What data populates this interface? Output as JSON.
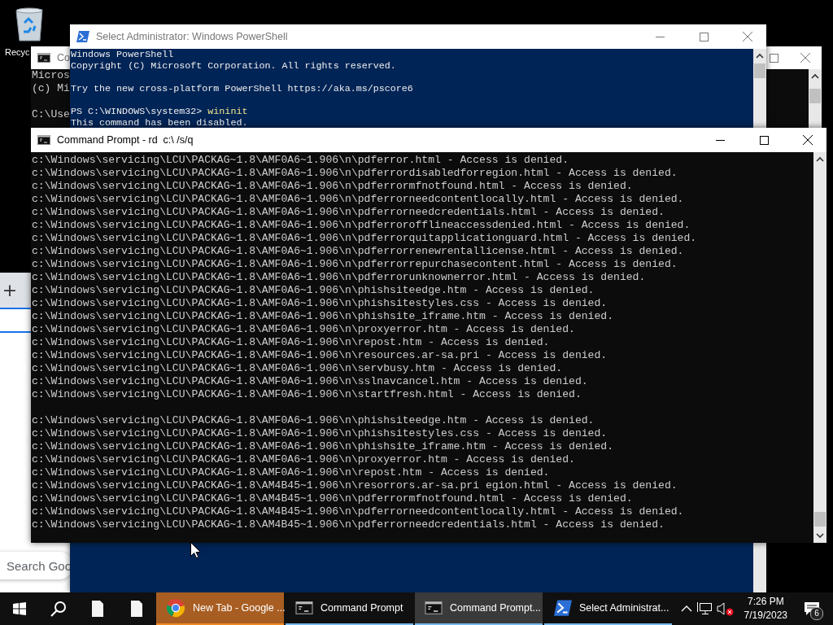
{
  "desktop": {
    "icon_label": "Recyc"
  },
  "back_console": {
    "title": "Co",
    "blocks": [
      {
        "lines": [
          {
            "text": "Micros"
          },
          {
            "text": "(c) Mi"
          }
        ]
      },
      {
        "lines": [
          {
            "text": "C:\\Use"
          }
        ]
      }
    ]
  },
  "powershell": {
    "title": "Select Administrator: Windows PowerShell",
    "blocks": [
      {
        "lines": [
          {
            "text": "Windows PowerShell"
          },
          {
            "text": "Copyright (C) Microsoft Corporation. All rights reserved."
          }
        ]
      },
      {
        "lines": [
          {
            "text": "Try the new cross-platform PowerShell https://aka.ms/pscore6"
          }
        ]
      },
      {
        "lines": [
          {
            "text": "PS C:\\WINDOWS\\system32> ",
            "command": "wininit"
          },
          {
            "text": "This command has been disabled."
          }
        ]
      }
    ]
  },
  "browser": {
    "new_tab_button": "+",
    "search_placeholder": "Search Goo"
  },
  "console": {
    "title": "Command Prompt - rd  c:\\ /s/q",
    "blocks": [
      {
        "lines": [
          {
            "text": "c:\\Windows\\servicing\\LCU\\PACKAG~1.8\\AMF0A6~1.906\\n\\pdferror.html - Access is denied."
          },
          {
            "text": "c:\\Windows\\servicing\\LCU\\PACKAG~1.8\\AMF0A6~1.906\\n\\pdferrordisabledforregion.html - Access is denied."
          },
          {
            "text": "c:\\Windows\\servicing\\LCU\\PACKAG~1.8\\AMF0A6~1.906\\n\\pdferrormfnotfound.html - Access is denied."
          },
          {
            "text": "c:\\Windows\\servicing\\LCU\\PACKAG~1.8\\AMF0A6~1.906\\n\\pdferrorneedcontentlocally.html - Access is denied."
          },
          {
            "text": "c:\\Windows\\servicing\\LCU\\PACKAG~1.8\\AMF0A6~1.906\\n\\pdferrorneedcredentials.html - Access is denied."
          },
          {
            "text": "c:\\Windows\\servicing\\LCU\\PACKAG~1.8\\AMF0A6~1.906\\n\\pdferrorofflineaccessdenied.html - Access is denied."
          },
          {
            "text": "c:\\Windows\\servicing\\LCU\\PACKAG~1.8\\AMF0A6~1.906\\n\\pdferrorquitapplicationguard.html - Access is denied."
          },
          {
            "text": "c:\\Windows\\servicing\\LCU\\PACKAG~1.8\\AMF0A6~1.906\\n\\pdferrorrenewrentallicense.html - Access is denied."
          },
          {
            "text": "c:\\Windows\\servicing\\LCU\\PACKAG~1.8\\AMF0A6~1.906\\n\\pdferrorrepurchasecontent.html - Access is denied."
          },
          {
            "text": "c:\\Windows\\servicing\\LCU\\PACKAG~1.8\\AMF0A6~1.906\\n\\pdferrorunknownerror.html - Access is denied."
          },
          {
            "text": "c:\\Windows\\servicing\\LCU\\PACKAG~1.8\\AMF0A6~1.906\\n\\phishsiteedge.htm - Access is denied."
          },
          {
            "text": "c:\\Windows\\servicing\\LCU\\PACKAG~1.8\\AMF0A6~1.906\\n\\phishsitestyles.css - Access is denied."
          },
          {
            "text": "c:\\Windows\\servicing\\LCU\\PACKAG~1.8\\AMF0A6~1.906\\n\\phishsite_iframe.htm - Access is denied."
          },
          {
            "text": "c:\\Windows\\servicing\\LCU\\PACKAG~1.8\\AMF0A6~1.906\\n\\proxyerror.htm - Access is denied."
          },
          {
            "text": "c:\\Windows\\servicing\\LCU\\PACKAG~1.8\\AMF0A6~1.906\\n\\repost.htm - Access is denied."
          },
          {
            "text": "c:\\Windows\\servicing\\LCU\\PACKAG~1.8\\AMF0A6~1.906\\n\\resources.ar-sa.pri - Access is denied."
          },
          {
            "text": "c:\\Windows\\servicing\\LCU\\PACKAG~1.8\\AMF0A6~1.906\\n\\servbusy.htm - Access is denied."
          },
          {
            "text": "c:\\Windows\\servicing\\LCU\\PACKAG~1.8\\AMF0A6~1.906\\n\\sslnavcancel.htm - Access is denied."
          },
          {
            "text": "c:\\Windows\\servicing\\LCU\\PACKAG~1.8\\AMF0A6~1.906\\n\\startfresh.html - Access is denied."
          }
        ]
      },
      {
        "lines": [
          {
            "text": "c:\\Windows\\servicing\\LCU\\PACKAG~1.8\\AMF0A6~1.906\\n\\phishsiteedge.htm - Access is denied."
          },
          {
            "text": "c:\\Windows\\servicing\\LCU\\PACKAG~1.8\\AMF0A6~1.906\\n\\phishsitestyles.css - Access is denied."
          },
          {
            "text": "c:\\Windows\\servicing\\LCU\\PACKAG~1.8\\AMF0A6~1.906\\n\\phishsite_iframe.htm - Access is denied."
          },
          {
            "text": "c:\\Windows\\servicing\\LCU\\PACKAG~1.8\\AMF0A6~1.906\\n\\proxyerror.htm - Access is denied."
          },
          {
            "text": "c:\\Windows\\servicing\\LCU\\PACKAG~1.8\\AMF0A6~1.906\\n\\repost.htm - Access is denied."
          },
          {
            "text": "c:\\Windows\\servicing\\LCU\\PACKAG~1.8\\AM4B45~1.906\\n\\resorrors.ar-sa.pri egion.html - Access is denied."
          },
          {
            "text": "c:\\Windows\\servicing\\LCU\\PACKAG~1.8\\AM4B45~1.906\\n\\pdferrormfnotfound.html - Access is denied."
          },
          {
            "text": "c:\\Windows\\servicing\\LCU\\PACKAG~1.8\\AM4B45~1.906\\n\\pdferrorneedcontentlocally.html - Access is denied."
          },
          {
            "text": "c:\\Windows\\servicing\\LCU\\PACKAG~1.8\\AM4B45~1.906\\n\\pdferrorneedcredentials.html - Access is denied."
          }
        ]
      }
    ]
  },
  "taskbar": {
    "pinned": [
      {
        "kind": "start"
      },
      {
        "kind": "search"
      },
      {
        "kind": "file"
      },
      {
        "kind": "file"
      }
    ],
    "buttons": [
      {
        "kind": "browser",
        "label": "New Tab - Google ...",
        "selected": false,
        "flashing": true
      },
      {
        "kind": "console",
        "label": "Command Prompt",
        "selected": false,
        "flashing": false
      },
      {
        "kind": "console",
        "label": "Command Prompt...",
        "selected": true,
        "flashing": false
      },
      {
        "kind": "powershell",
        "label": "Select Administrat...",
        "selected": false,
        "flashing": false
      }
    ],
    "tray": {
      "time": "7:26 PM",
      "date": "7/19/2023",
      "notification_count": "6",
      "muted": true
    }
  }
}
